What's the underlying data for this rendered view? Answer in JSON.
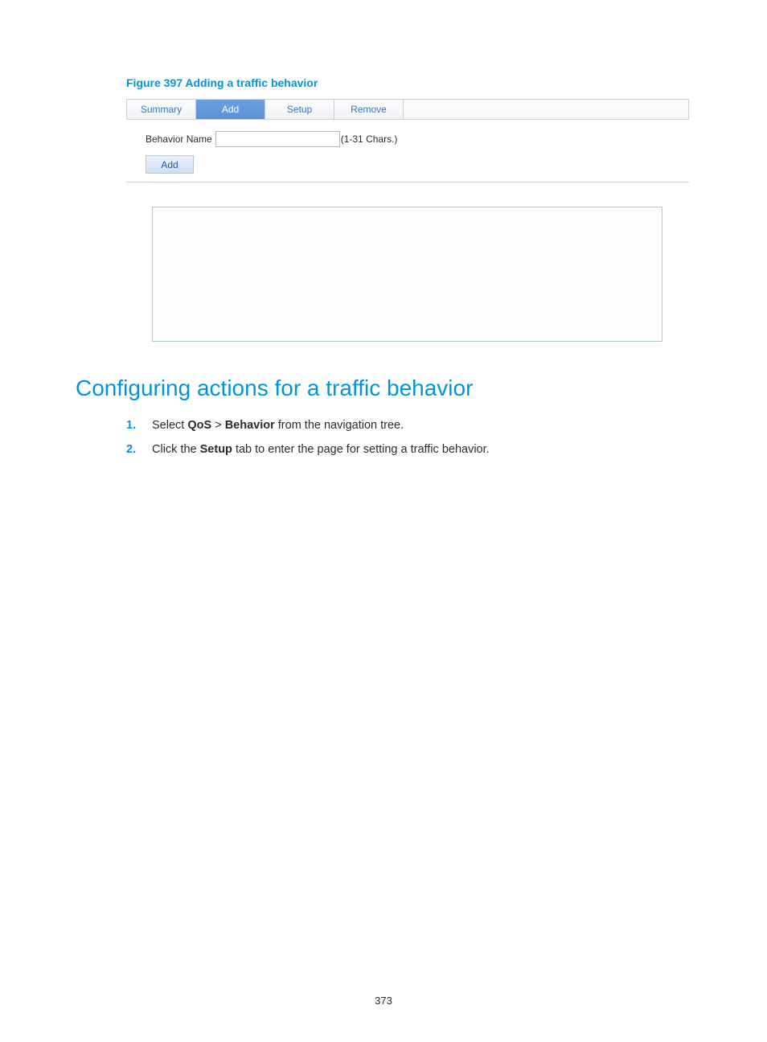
{
  "figure_caption": "Figure 397 Adding a traffic behavior",
  "tabs": {
    "summary": "Summary",
    "add": "Add",
    "setup": "Setup",
    "remove": "Remove"
  },
  "form": {
    "behavior_label": "Behavior Name",
    "behavior_value": "",
    "hint": "(1-31 Chars.)",
    "add_button": "Add"
  },
  "section_heading": "Configuring actions for a traffic behavior",
  "steps": [
    {
      "num": "1.",
      "pre": "Select ",
      "b1": "QoS",
      "mid": " > ",
      "b2": "Behavior",
      "post": " from the navigation tree."
    },
    {
      "num": "2.",
      "pre": "Click the ",
      "b1": "Setup",
      "mid": "",
      "b2": "",
      "post": " tab to enter the page for setting a traffic behavior."
    }
  ],
  "page_number": "373"
}
